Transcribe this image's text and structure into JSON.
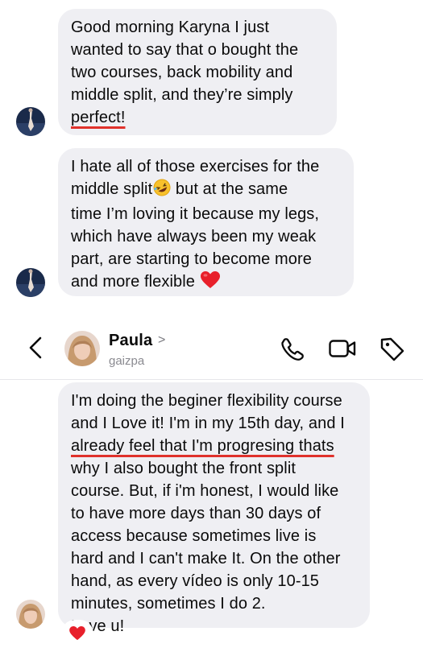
{
  "thread": {
    "messages": [
      {
        "lines": [
          "Good morning Karyna I just",
          "wanted to say that o bought the",
          "two courses, back mobility and",
          "middle split, and they’re simply"
        ],
        "underlined": "perfect!"
      },
      {
        "line1": "I hate all of those exercises for the",
        "line2": "middle split",
        "line3": "time I’m loving it because  my legs,",
        "line4": "which have always been my weak",
        "line5": "part, are starting to become more",
        "line6": "and more flexible",
        "after_emoji": " but at the same"
      },
      {
        "line1": "I'm doing the beginer flexibility course",
        "line2": "and I Love it! I'm in my 15th day, and I",
        "underlined": "already feel that I'm progresing thats",
        "line4": "why I also bought the front split",
        "line5": "course. But, if i'm honest, I would like",
        "line6": "to have more days than 30 days of",
        "line7": "access because sometimes live is",
        "line8": "hard and I can't make It. On the other",
        "line9": "hand, as every vídeo is only 10-15",
        "line10": "minutes, sometimes I do 2.",
        "line11": "Love u!"
      }
    ]
  },
  "header": {
    "name": "Paula",
    "chevron": ">",
    "username": "gaizpa"
  },
  "icons": {
    "back": "chevron-left-icon",
    "call": "phone-icon",
    "video": "video-camera-icon",
    "tag": "tag-icon",
    "heart": "red-heart-emoji",
    "laugh": "rolling-laughing-emoji"
  },
  "colors": {
    "bubble": "#efeff3",
    "underline": "#e0312b",
    "heart": "#e8202b"
  }
}
